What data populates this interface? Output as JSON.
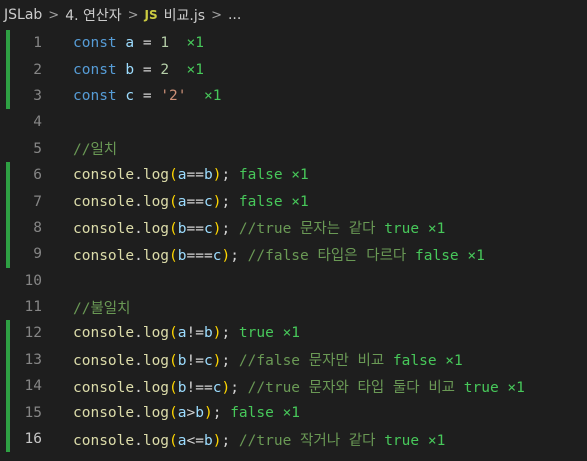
{
  "breadcrumb": {
    "items": [
      "JSLab",
      "4. 연산자",
      "비교.js",
      "..."
    ],
    "file_badge": "JS"
  },
  "editor": {
    "active_line": 16,
    "lines": [
      {
        "n": "1",
        "changed": true,
        "tokens": [
          [
            "kw",
            "const "
          ],
          [
            "var",
            "a"
          ],
          [
            "op",
            " = "
          ],
          [
            "num",
            "1"
          ],
          [
            "op",
            "  "
          ],
          [
            "res",
            "×1"
          ]
        ]
      },
      {
        "n": "2",
        "changed": true,
        "tokens": [
          [
            "kw",
            "const "
          ],
          [
            "var",
            "b"
          ],
          [
            "op",
            " = "
          ],
          [
            "num",
            "2"
          ],
          [
            "op",
            "  "
          ],
          [
            "res",
            "×1"
          ]
        ]
      },
      {
        "n": "3",
        "changed": true,
        "tokens": [
          [
            "kw",
            "const "
          ],
          [
            "var",
            "c"
          ],
          [
            "op",
            " = "
          ],
          [
            "str",
            "'2'"
          ],
          [
            "op",
            "  "
          ],
          [
            "res",
            "×1"
          ]
        ]
      },
      {
        "n": "4",
        "changed": false,
        "tokens": []
      },
      {
        "n": "5",
        "changed": false,
        "tokens": [
          [
            "cm",
            "//일치"
          ]
        ]
      },
      {
        "n": "6",
        "changed": true,
        "tokens": [
          [
            "obj",
            "console"
          ],
          [
            "op",
            "."
          ],
          [
            "fn",
            "log"
          ],
          [
            "paren",
            "("
          ],
          [
            "var",
            "a"
          ],
          [
            "op",
            "=="
          ],
          [
            "var",
            "b"
          ],
          [
            "paren",
            ")"
          ],
          [
            "op",
            "; "
          ],
          [
            "res",
            "false ×1"
          ]
        ]
      },
      {
        "n": "7",
        "changed": true,
        "tokens": [
          [
            "obj",
            "console"
          ],
          [
            "op",
            "."
          ],
          [
            "fn",
            "log"
          ],
          [
            "paren",
            "("
          ],
          [
            "var",
            "a"
          ],
          [
            "op",
            "=="
          ],
          [
            "var",
            "c"
          ],
          [
            "paren",
            ")"
          ],
          [
            "op",
            "; "
          ],
          [
            "res",
            "false ×1"
          ]
        ]
      },
      {
        "n": "8",
        "changed": true,
        "tokens": [
          [
            "obj",
            "console"
          ],
          [
            "op",
            "."
          ],
          [
            "fn",
            "log"
          ],
          [
            "paren",
            "("
          ],
          [
            "var",
            "b"
          ],
          [
            "op",
            "=="
          ],
          [
            "var",
            "c"
          ],
          [
            "paren",
            ")"
          ],
          [
            "op",
            "; "
          ],
          [
            "cm",
            "//true 문자는 같다 "
          ],
          [
            "res",
            "true ×1"
          ]
        ]
      },
      {
        "n": "9",
        "changed": true,
        "tokens": [
          [
            "obj",
            "console"
          ],
          [
            "op",
            "."
          ],
          [
            "fn",
            "log"
          ],
          [
            "paren",
            "("
          ],
          [
            "var",
            "b"
          ],
          [
            "op",
            "==="
          ],
          [
            "var",
            "c"
          ],
          [
            "paren",
            ")"
          ],
          [
            "op",
            "; "
          ],
          [
            "cm",
            "//false 타입은 다르다 "
          ],
          [
            "res",
            "false ×1"
          ]
        ]
      },
      {
        "n": "10",
        "changed": false,
        "tokens": []
      },
      {
        "n": "11",
        "changed": false,
        "tokens": [
          [
            "cm",
            "//불일치"
          ]
        ]
      },
      {
        "n": "12",
        "changed": true,
        "tokens": [
          [
            "obj",
            "console"
          ],
          [
            "op",
            "."
          ],
          [
            "fn",
            "log"
          ],
          [
            "paren",
            "("
          ],
          [
            "var",
            "a"
          ],
          [
            "op",
            "!="
          ],
          [
            "var",
            "b"
          ],
          [
            "paren",
            ")"
          ],
          [
            "op",
            "; "
          ],
          [
            "res",
            "true ×1"
          ]
        ]
      },
      {
        "n": "13",
        "changed": true,
        "tokens": [
          [
            "obj",
            "console"
          ],
          [
            "op",
            "."
          ],
          [
            "fn",
            "log"
          ],
          [
            "paren",
            "("
          ],
          [
            "var",
            "b"
          ],
          [
            "op",
            "!="
          ],
          [
            "var",
            "c"
          ],
          [
            "paren",
            ")"
          ],
          [
            "op",
            "; "
          ],
          [
            "cm",
            "//false 문자만 비교 "
          ],
          [
            "res",
            "false ×1"
          ]
        ]
      },
      {
        "n": "14",
        "changed": true,
        "tokens": [
          [
            "obj",
            "console"
          ],
          [
            "op",
            "."
          ],
          [
            "fn",
            "log"
          ],
          [
            "paren",
            "("
          ],
          [
            "var",
            "b"
          ],
          [
            "op",
            "!=="
          ],
          [
            "var",
            "c"
          ],
          [
            "paren",
            ")"
          ],
          [
            "op",
            "; "
          ],
          [
            "cm",
            "//true 문자와 타입 둘다 비교 "
          ],
          [
            "res",
            "true ×1"
          ]
        ]
      },
      {
        "n": "15",
        "changed": true,
        "tokens": [
          [
            "obj",
            "console"
          ],
          [
            "op",
            "."
          ],
          [
            "fn",
            "log"
          ],
          [
            "paren",
            "("
          ],
          [
            "var",
            "a"
          ],
          [
            "op",
            ">"
          ],
          [
            "var",
            "b"
          ],
          [
            "paren",
            ")"
          ],
          [
            "op",
            "; "
          ],
          [
            "res",
            "false ×1"
          ]
        ]
      },
      {
        "n": "16",
        "changed": true,
        "tokens": [
          [
            "obj",
            "console"
          ],
          [
            "op",
            "."
          ],
          [
            "fn",
            "log"
          ],
          [
            "paren",
            "("
          ],
          [
            "var",
            "a"
          ],
          [
            "op",
            "<="
          ],
          [
            "var",
            "b"
          ],
          [
            "paren",
            ")"
          ],
          [
            "op",
            "; "
          ],
          [
            "cm",
            "//true 작거나 같다 "
          ],
          [
            "res",
            "true ×1"
          ]
        ]
      }
    ]
  }
}
